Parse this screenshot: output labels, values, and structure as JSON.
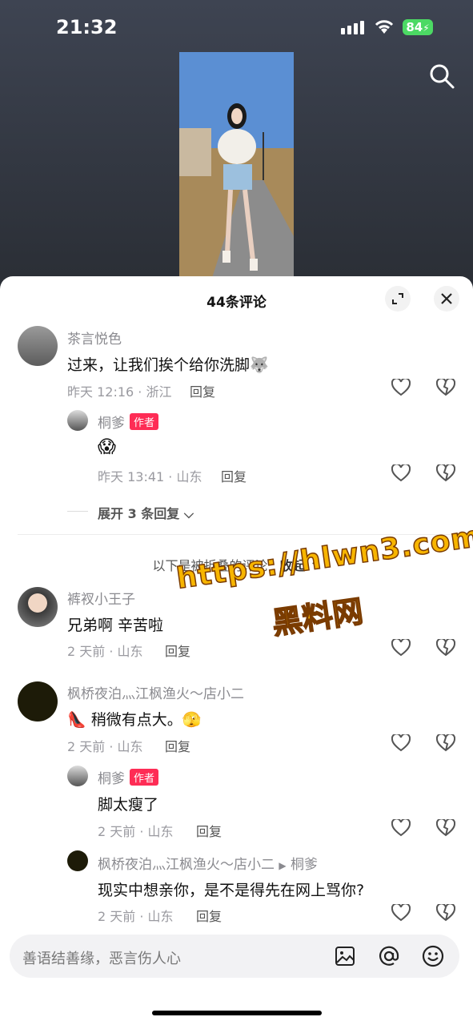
{
  "status_bar": {
    "time": "21:32",
    "battery": "84"
  },
  "sheet": {
    "title": "44条评论"
  },
  "comments": [
    {
      "user": "茶言悦色",
      "text": "过来，让我们挨个给你洗脚🐺",
      "meta": "昨天 12:16 · 浙江",
      "reply": "回复"
    },
    {
      "user": "桐爹",
      "badge": "作者",
      "text": "😱",
      "meta": "昨天 13:41 · 山东",
      "reply": "回复"
    }
  ],
  "expand_label": "展开 3 条回复",
  "folded": {
    "text": "以下是被折叠的评论",
    "collapse": "收起"
  },
  "folded_comments": [
    {
      "user": "裤衩小王子",
      "text": "兄弟啊 辛苦啦",
      "meta": "2 天前 · 山东",
      "reply": "回复"
    },
    {
      "user": "枫桥夜泊灬江枫渔火～店小二",
      "text": "👠 稍微有点大。🫣",
      "meta": "2 天前 · 山东",
      "reply": "回复"
    },
    {
      "user": "桐爹",
      "badge": "作者",
      "text": "脚太瘦了",
      "meta": "2 天前 · 山东",
      "reply": "回复"
    },
    {
      "user": "枫桥夜泊灬江枫渔火～店小二",
      "reply_to": "桐爹",
      "text": "现实中想亲你，是不是得先在网上骂你?",
      "meta": "2 天前 · 山东",
      "reply": "回复"
    }
  ],
  "watermark": {
    "line1": "https://hlwn3.com",
    "line2": "黑料网"
  },
  "input": {
    "placeholder": "善语结善缘，恶言伤人心"
  },
  "icons": [
    "search-icon",
    "expand-icon",
    "close-icon",
    "heart-icon",
    "dislike-icon",
    "image-icon",
    "at-icon",
    "emoji-icon"
  ]
}
